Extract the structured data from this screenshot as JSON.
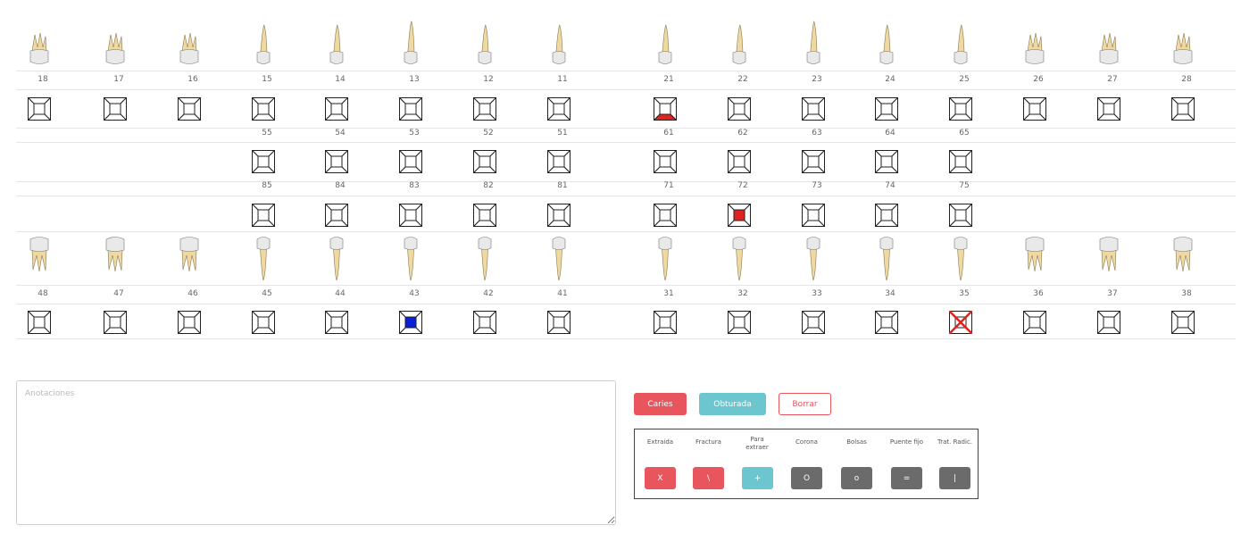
{
  "upper_permanent": [
    "18",
    "17",
    "16",
    "15",
    "14",
    "13",
    "12",
    "11",
    "21",
    "22",
    "23",
    "24",
    "25",
    "26",
    "27",
    "28"
  ],
  "upper_deciduous": [
    "55",
    "54",
    "53",
    "52",
    "51",
    "61",
    "62",
    "63",
    "64",
    "65"
  ],
  "lower_deciduous": [
    "85",
    "84",
    "83",
    "82",
    "81",
    "71",
    "72",
    "73",
    "74",
    "75"
  ],
  "lower_permanent": [
    "48",
    "47",
    "46",
    "45",
    "44",
    "43",
    "42",
    "41",
    "31",
    "32",
    "33",
    "34",
    "35",
    "36",
    "37",
    "38"
  ],
  "marks": {
    "21": {
      "type": "bottom",
      "color": "#e0231f"
    },
    "72": {
      "type": "center",
      "color": "#e0231f"
    },
    "43": {
      "type": "center",
      "color": "#0a1fd6"
    },
    "35": {
      "type": "x",
      "color": "#e0231f"
    }
  },
  "notes": {
    "placeholder": "Anotaciones",
    "value": ""
  },
  "actions": {
    "caries_label": "Caries",
    "obturada_label": "Obturada",
    "borrar_label": "Borrar",
    "caries_color": "#e8555c",
    "obturada_color": "#6bc6cf"
  },
  "legend": [
    {
      "label": "Extraida",
      "symbol": "X",
      "color": "#e8555c"
    },
    {
      "label": "Fractura",
      "symbol": "\\",
      "color": "#e8555c"
    },
    {
      "label": "Para extraer",
      "symbol": "+",
      "color": "#6bc6cf"
    },
    {
      "label": "Corona",
      "symbol": "O",
      "color": "#6b6b6b"
    },
    {
      "label": "Bolsas",
      "symbol": "o",
      "color": "#6b6b6b"
    },
    {
      "label": "Puente fijo",
      "symbol": "=",
      "color": "#6b6b6b"
    },
    {
      "label": "Trat. Radic.",
      "symbol": "|",
      "color": "#6b6b6b"
    }
  ]
}
